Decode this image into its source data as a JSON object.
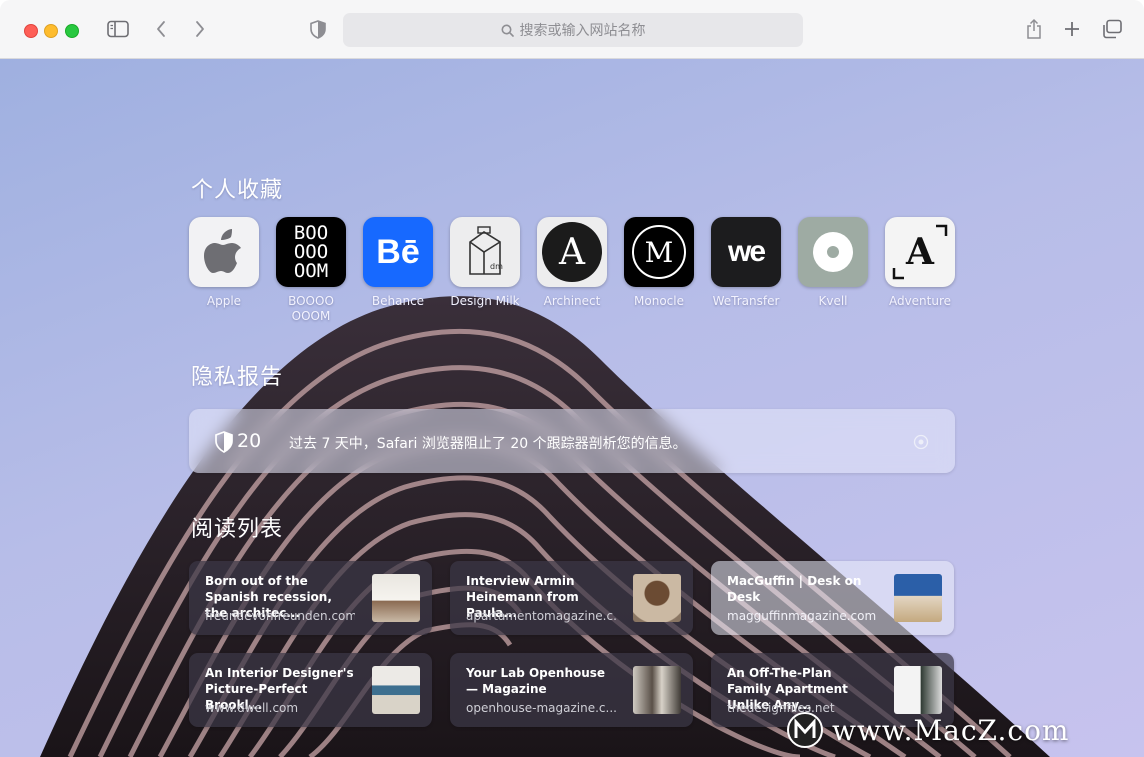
{
  "address_bar": {
    "placeholder": "搜索或输入网站名称"
  },
  "favorites": {
    "title": "个人收藏",
    "items": [
      {
        "label": "Apple",
        "icon": "apple-logo-icon"
      },
      {
        "label": "BOOOO\nOOOM",
        "icon": "boooooom-logo-icon",
        "logo_text": "BOO\nOOO\nOOM"
      },
      {
        "label": "Behance",
        "icon": "behance-logo-icon",
        "logo_text": "Bē"
      },
      {
        "label": "Design Milk",
        "icon": "design-milk-logo-icon",
        "logo_text": "dm"
      },
      {
        "label": "Archinect",
        "icon": "archinect-logo-icon",
        "logo_text": "A"
      },
      {
        "label": "Monocle",
        "icon": "monocle-logo-icon",
        "logo_text": "M"
      },
      {
        "label": "WeTransfer",
        "icon": "wetransfer-logo-icon",
        "logo_text": "we"
      },
      {
        "label": "Kvell",
        "icon": "kvell-logo-icon"
      },
      {
        "label": "Adventure",
        "icon": "adventure-logo-icon",
        "logo_text": "A"
      }
    ]
  },
  "privacy": {
    "title": "隐私报告",
    "tracker_count": "20",
    "message": "过去 7 天中，Safari 浏览器阻止了 20 个跟踪器剖析您的信息。"
  },
  "reading_list": {
    "title": "阅读列表",
    "items": [
      {
        "title": "Born out of the Spanish recession, the architec...",
        "domain": "freundevonfreunden.com"
      },
      {
        "title": "Interview Armin Heinemann from Paula...",
        "domain": "apartamentomagazine.c..."
      },
      {
        "title": "MacGuffin | Desk on Desk",
        "domain": "magguffinmagazine.com"
      },
      {
        "title": "An Interior Designer's Picture-Perfect Brookl...",
        "domain": "www.dwell.com"
      },
      {
        "title": "Your Lab Openhouse — Magazine",
        "domain": "openhouse-magazine.c..."
      },
      {
        "title": "An Off-The-Plan Family Apartment Unlike Any...",
        "domain": "thedesignfiles.net"
      }
    ]
  },
  "watermark": {
    "text": "www.MacZ.com"
  },
  "colors": {
    "close": "#fe5f57",
    "minimize": "#febc2e",
    "maximize": "#28c840",
    "behance": "#1769ff"
  }
}
